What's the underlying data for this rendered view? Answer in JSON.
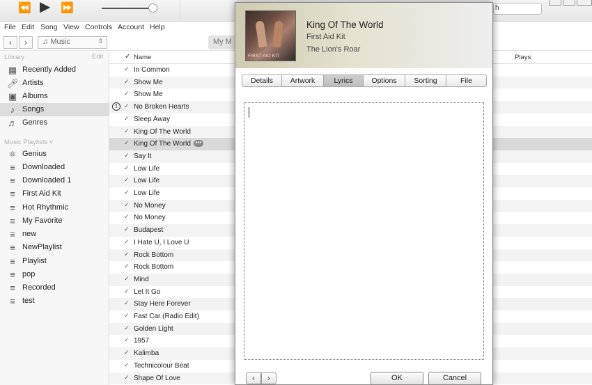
{
  "player": {
    "prev_icon": "⏪",
    "play_icon": "▶",
    "next_icon": "⏩",
    "search_value": "h"
  },
  "menu": [
    "File",
    "Edit",
    "Song",
    "View",
    "Controls",
    "Account",
    "Help"
  ],
  "nav": {
    "back_icon": "‹",
    "forward_icon": "›",
    "media_label": "Music",
    "media_icon": "♫",
    "my_music_tab": "My M"
  },
  "sidebar": {
    "library_heading": "Library",
    "edit_label": "Edit",
    "library_items": [
      {
        "label": "Recently Added",
        "icon": "calendar-grid-icon"
      },
      {
        "label": "Artists",
        "icon": "microphone-icon"
      },
      {
        "label": "Albums",
        "icon": "album-icon"
      },
      {
        "label": "Songs",
        "icon": "note-icon",
        "selected": true
      },
      {
        "label": "Genres",
        "icon": "genres-icon"
      }
    ],
    "playlists_heading": "Music Playlists ˅",
    "playlists": [
      {
        "label": "Genius",
        "icon": "genius-atom-icon"
      },
      {
        "label": "Downloaded",
        "icon": "playlist-icon"
      },
      {
        "label": "Downloaded 1",
        "icon": "playlist-icon"
      },
      {
        "label": "First Aid Kit",
        "icon": "playlist-icon"
      },
      {
        "label": "Hot Rhythmic",
        "icon": "playlist-icon"
      },
      {
        "label": "My Favorite",
        "icon": "playlist-icon"
      },
      {
        "label": "new",
        "icon": "playlist-icon"
      },
      {
        "label": "NewPlaylist",
        "icon": "playlist-icon"
      },
      {
        "label": "Playlist",
        "icon": "playlist-icon"
      },
      {
        "label": "pop",
        "icon": "playlist-icon"
      },
      {
        "label": "Recorded",
        "icon": "playlist-icon"
      },
      {
        "label": "test",
        "icon": "playlist-icon"
      }
    ]
  },
  "songs": {
    "header_check": "✓",
    "header_name": "Name",
    "header_plays": "Plays",
    "rows": [
      {
        "name": "In Common"
      },
      {
        "name": "Show Me"
      },
      {
        "name": "Show Me"
      },
      {
        "name": "No Broken Hearts",
        "warning": true
      },
      {
        "name": "Sleep Away"
      },
      {
        "name": "King Of The World"
      },
      {
        "name": "King Of The World",
        "selected": true,
        "more": true
      },
      {
        "name": "Say It"
      },
      {
        "name": "Low Life"
      },
      {
        "name": "Low Life"
      },
      {
        "name": "Low Life"
      },
      {
        "name": "No Money"
      },
      {
        "name": "No Money"
      },
      {
        "name": "Budapest"
      },
      {
        "name": "I Hate U, I Love U"
      },
      {
        "name": "Rock Bottom"
      },
      {
        "name": "Rock Bottom"
      },
      {
        "name": "Mind"
      },
      {
        "name": "Let It Go"
      },
      {
        "name": "Stay Here Forever"
      },
      {
        "name": "Fast Car (Radio Edit)"
      },
      {
        "name": "Golden Light"
      },
      {
        "name": "1957"
      },
      {
        "name": "Kalimba"
      },
      {
        "name": "Technicolour Beat"
      },
      {
        "name": "Shape Of Love"
      }
    ]
  },
  "dialog": {
    "title": "King Of The World",
    "artist": "First Aid Kit",
    "album": "The Lion's Roar",
    "album_art_text": "FIRST AID KIT",
    "tabs": {
      "details": "Details",
      "artwork": "Artwork",
      "lyrics": "Lyrics",
      "options": "Options",
      "sorting": "Sorting",
      "file": "File"
    },
    "active_tab": "Lyrics",
    "lyrics_value": "",
    "prev_icon": "‹",
    "next_icon": "›",
    "ok_label": "OK",
    "cancel_label": "Cancel"
  },
  "colors": {
    "selection": "#d9d9d9",
    "sidebar_bg": "#f7f7f7",
    "header_gradient_start": "#cfcbb0"
  }
}
